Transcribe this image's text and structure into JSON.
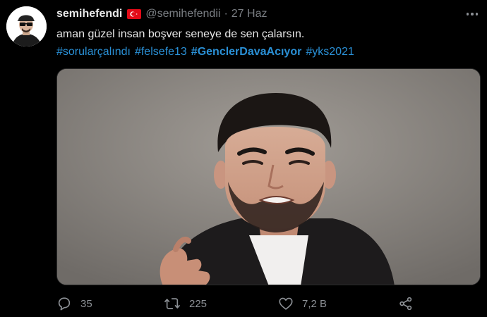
{
  "tweet": {
    "display_name": "semihefendi",
    "flag_icon": "turkey-flag-icon",
    "handle": "@semihefendii",
    "separator": "·",
    "date": "27 Haz",
    "text": "aman güzel insan boşver seneye de sen çalarsın.",
    "hashtags": [
      {
        "text": "#sorularçalındı",
        "bold": false
      },
      {
        "text": "#felsefe13",
        "bold": false
      },
      {
        "text": "#GenclerDavaAcıyor",
        "bold": true
      },
      {
        "text": "#yks2021",
        "bold": false
      }
    ]
  },
  "actions": {
    "reply": {
      "icon": "reply-icon",
      "count": "35"
    },
    "retweet": {
      "icon": "retweet-icon",
      "count": "225"
    },
    "like": {
      "icon": "heart-icon",
      "count": "7,2 B"
    },
    "share": {
      "icon": "share-icon"
    }
  },
  "colors": {
    "background": "#000000",
    "hashtag": "#2a90d6",
    "muted": "#7b7f84",
    "text": "#e6e6e6"
  }
}
